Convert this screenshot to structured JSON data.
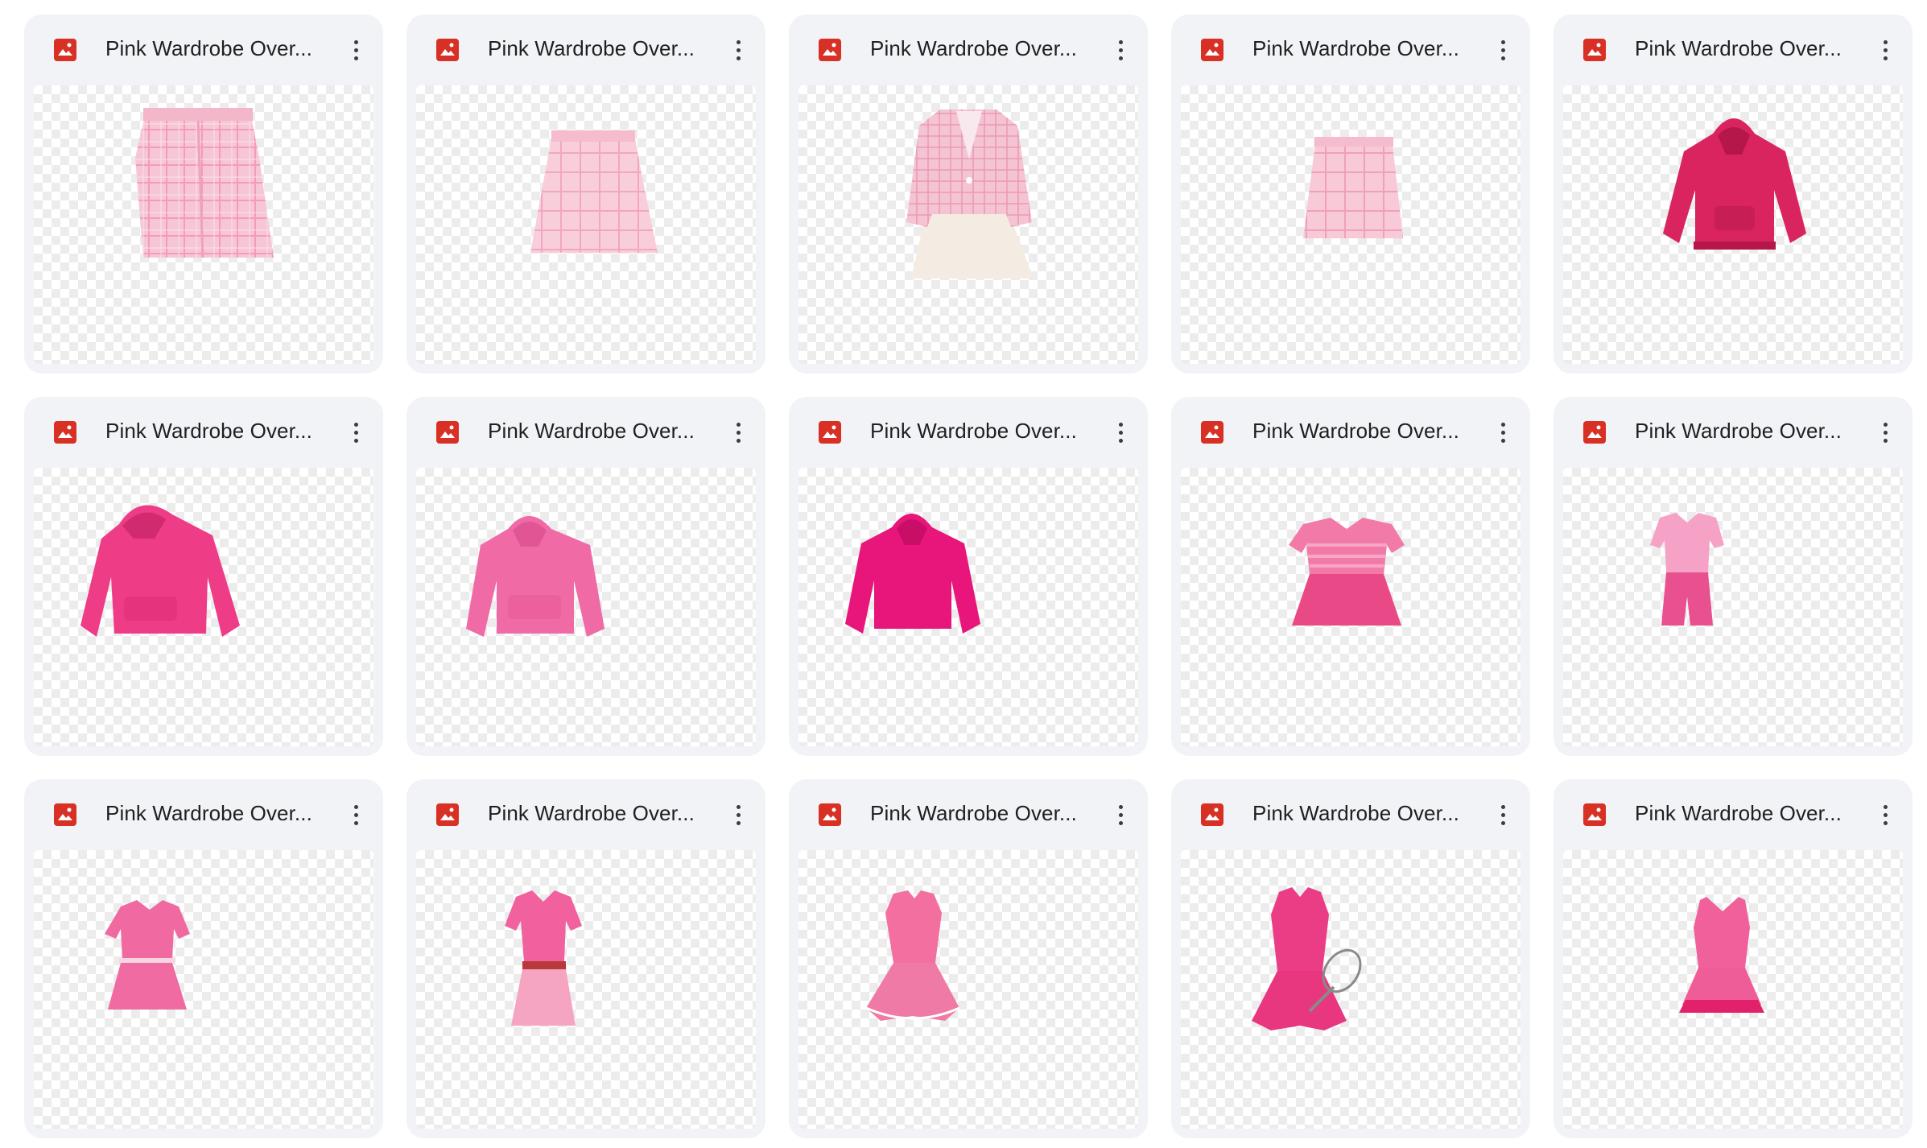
{
  "colors": {
    "card_bg": "#f1f3f6",
    "file_icon": "#d93025",
    "checker": "#ececec"
  },
  "files": [
    {
      "title": "Pink Wardrobe Over...",
      "icon": "image-file-icon",
      "item": "plaid-skirt"
    },
    {
      "title": "Pink Wardrobe Over...",
      "icon": "image-file-icon",
      "item": "plaid-skirt-light"
    },
    {
      "title": "Pink Wardrobe Over...",
      "icon": "image-file-icon",
      "item": "plaid-blazer-outfit"
    },
    {
      "title": "Pink Wardrobe Over...",
      "icon": "image-file-icon",
      "item": "plaid-skirt-short"
    },
    {
      "title": "Pink Wardrobe Over...",
      "icon": "image-file-icon",
      "item": "hoodie-deep"
    },
    {
      "title": "Pink Wardrobe Over...",
      "icon": "image-file-icon",
      "item": "hoodie-bright"
    },
    {
      "title": "Pink Wardrobe Over...",
      "icon": "image-file-icon",
      "item": "hoodie-light"
    },
    {
      "title": "Pink Wardrobe Over...",
      "icon": "image-file-icon",
      "item": "hoodie-magenta"
    },
    {
      "title": "Pink Wardrobe Over...",
      "icon": "image-file-icon",
      "item": "polo-skirt-outfit"
    },
    {
      "title": "Pink Wardrobe Over...",
      "icon": "image-file-icon",
      "item": "polo-shorts-outfit"
    },
    {
      "title": "Pink Wardrobe Over...",
      "icon": "image-file-icon",
      "item": "polo-pleated-skirt"
    },
    {
      "title": "Pink Wardrobe Over...",
      "icon": "image-file-icon",
      "item": "polo-belt-skirt"
    },
    {
      "title": "Pink Wardrobe Over...",
      "icon": "image-file-icon",
      "item": "sleeveless-ruffle-dress"
    },
    {
      "title": "Pink Wardrobe Over...",
      "icon": "image-file-icon",
      "item": "tennis-dress-racket"
    },
    {
      "title": "Pink Wardrobe Over...",
      "icon": "image-file-icon",
      "item": "tank-tennis-dress"
    }
  ]
}
